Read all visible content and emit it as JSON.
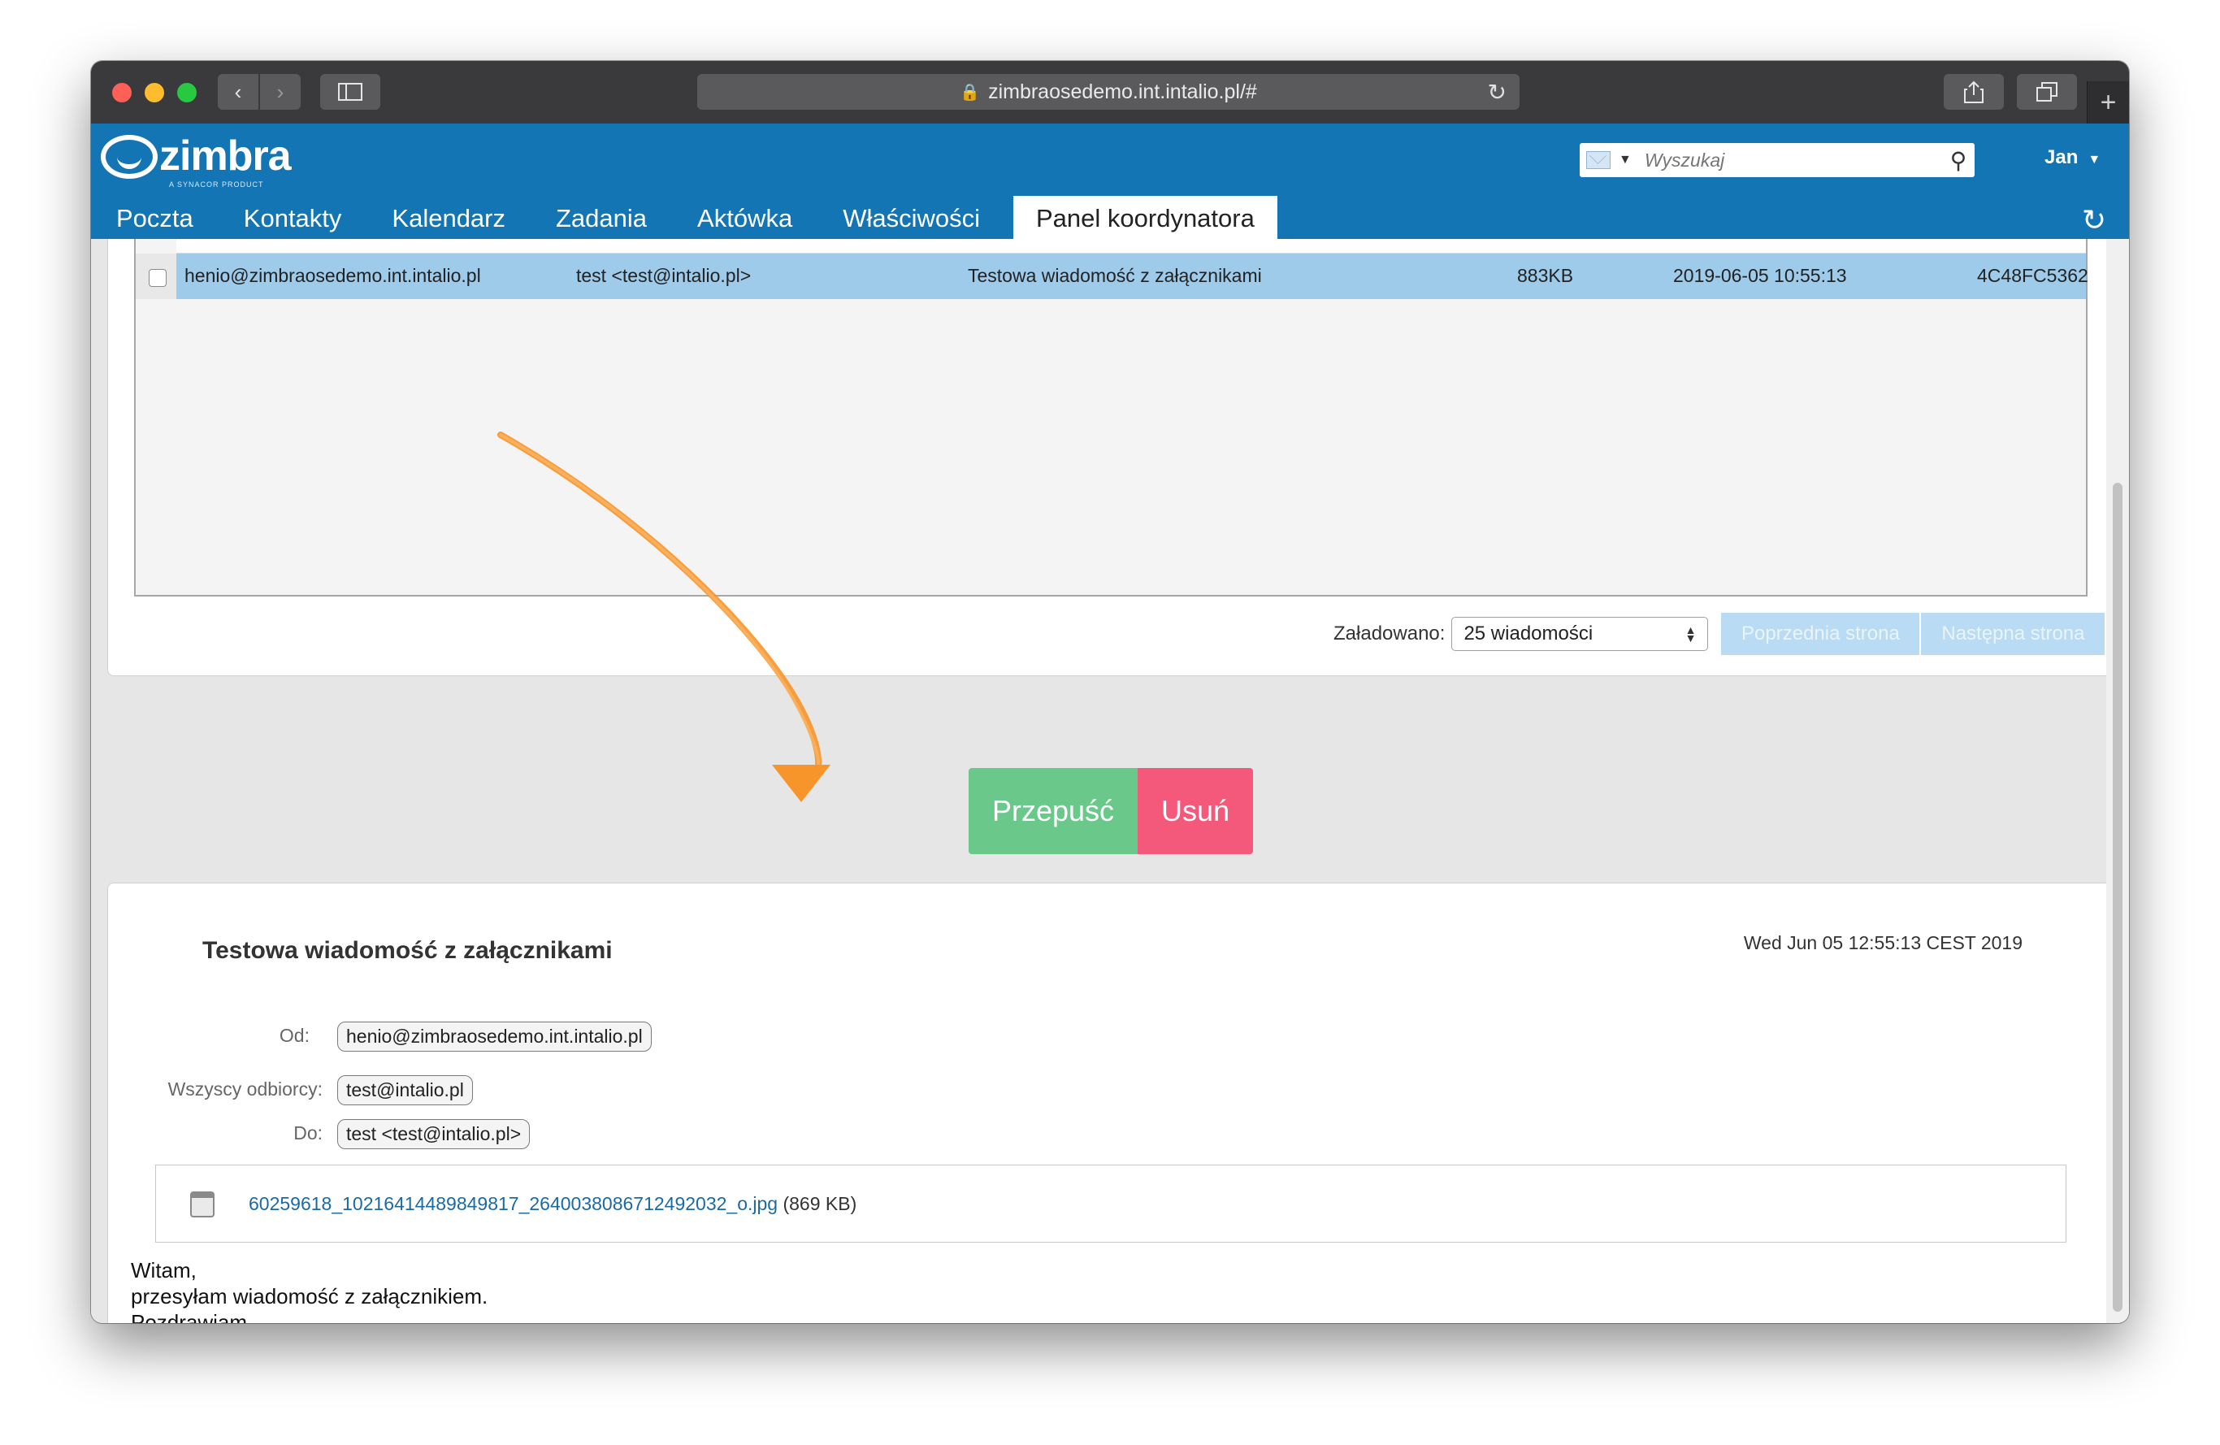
{
  "browser": {
    "url": "zimbraosedemo.int.intalio.pl/#"
  },
  "header": {
    "logo_text": "zimbra",
    "logo_subtext": "A SYNACOR PRODUCT",
    "search_placeholder": "Wyszukaj",
    "user_name": "Jan",
    "nav_tabs": [
      {
        "label": "Poczta"
      },
      {
        "label": "Kontakty"
      },
      {
        "label": "Kalendarz"
      },
      {
        "label": "Zadania"
      },
      {
        "label": "Aktówka"
      },
      {
        "label": "Właściwości"
      },
      {
        "label": "Panel koordynatora"
      }
    ],
    "active_tab": "Panel koordynatora"
  },
  "queue_list": {
    "rows": [
      {
        "from": "henio@zimbraosedemo.int.intalio.pl",
        "to": "test <test@intalio.pl>",
        "subject": "Testowa wiadomość z załącznikami",
        "size": "883KB",
        "date": "2019-06-05 10:55:13",
        "id": "4C48FC5362",
        "selected": true
      }
    ],
    "loaded_label": "Załadowano:",
    "loaded_value": "25 wiadomości",
    "prev_label": "Poprzednia strona",
    "next_label": "Następna strona"
  },
  "actions": {
    "pass_label": "Przepuść",
    "delete_label": "Usuń"
  },
  "message": {
    "subject": "Testowa wiadomość z załącznikami",
    "date": "Wed Jun 05 12:55:13 CEST 2019",
    "from_label": "Od:",
    "from_value": "henio@zimbraosedemo.int.intalio.pl",
    "all_recipients_label": "Wszyscy odbiorcy:",
    "all_recipients_value": "test@intalio.pl",
    "to_label": "Do:",
    "to_value": "test <test@intalio.pl>",
    "attachment_name": "60259618_10216414489849817_2640038086712492032_o.jpg",
    "attachment_size": "(869 KB)",
    "body_lines": [
      "Witam,",
      "przesyłam wiadomość z załącznikiem.",
      "Pozdrawiam."
    ]
  },
  "colors": {
    "header_blue": "#1475b5",
    "selected_row": "#9ecbea",
    "pass_green": "#6ac98a",
    "delete_red": "#f4587a",
    "annotation_arrow": "#f7942a"
  }
}
